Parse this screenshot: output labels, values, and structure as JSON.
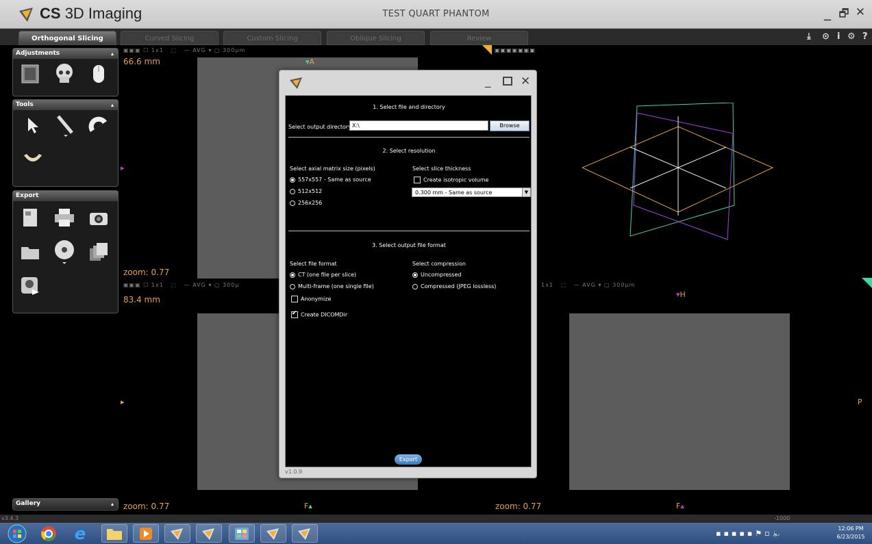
{
  "app": {
    "name_bold": "CS",
    "name_rest": "3D Imaging",
    "window_title": "TEST QUART PHANTOM",
    "version": "v3.4.3"
  },
  "tabs": [
    {
      "label": "Orthogonal Slicing",
      "active": true
    },
    {
      "label": "Curved Slicing",
      "active": false
    },
    {
      "label": "Custom Slicing",
      "active": false
    },
    {
      "label": "Oblique Slicing",
      "active": false
    },
    {
      "label": "Review",
      "active": false
    }
  ],
  "panels": {
    "adjustments": "Adjustments",
    "tools": "Tools",
    "export": "Export",
    "gallery": "Gallery"
  },
  "viewports": {
    "top_left": {
      "distance": "66.6 mm",
      "zoom": "zoom: 0.77",
      "toolbar_grid": "1x1",
      "toolbar_avg": "AVG ▾",
      "toolbar_thickness": "300µm",
      "marker_top": "A"
    },
    "bottom_left": {
      "distance": "83.4 mm",
      "zoom": "zoom: 0.77",
      "toolbar_grid": "1x1",
      "toolbar_avg": "AVG ▾",
      "toolbar_thickness": "300µ",
      "marker_bottom": "F"
    },
    "bottom_right": {
      "zoom": "zoom: 0.77",
      "toolbar_grid": "1x1",
      "toolbar_avg": "AVG ▾",
      "toolbar_thickness": "300µm",
      "marker_top": "H",
      "marker_bottom": "F",
      "marker_right": "P"
    }
  },
  "status": {
    "value": "-1000"
  },
  "dialog": {
    "version": "v1.0.9",
    "section1": "1. Select file and directory",
    "output_dir_label": "Select output directory",
    "output_dir_value": "X:\\",
    "browse_label": "Browse",
    "section2": "2. Select resolution",
    "matrix_label": "Select axial matrix size (pixels)",
    "matrix_options": [
      {
        "label": "557x557 - Same as source",
        "selected": true
      },
      {
        "label": "512x512",
        "selected": false
      },
      {
        "label": "256x256",
        "selected": false
      }
    ],
    "thickness_label": "Select slice thickness",
    "isotropic_label": "Create isotropic volume",
    "thickness_value": "0.300 mm - Same as source",
    "section3": "3. Select output file format",
    "format_label": "Select file format",
    "format_options": [
      {
        "label": "CT (one file per slice)",
        "selected": true
      },
      {
        "label": "Multi-frame (one single file)",
        "selected": false
      }
    ],
    "anonymize_label": "Anonymize",
    "dicomdir_label": "Create DICOMDir",
    "compression_label": "Select compression",
    "compression_options": [
      {
        "label": "Uncompressed",
        "selected": true
      },
      {
        "label": "Compressed (JPEG lossless)",
        "selected": false
      }
    ],
    "export_label": "Export"
  },
  "taskbar": {
    "time": "12:06 PM",
    "date": "6/23/2015"
  },
  "colors": {
    "accent_orange": "#e1a150",
    "marker_green": "#3fd7a8",
    "marker_magenta": "#c040c0"
  }
}
